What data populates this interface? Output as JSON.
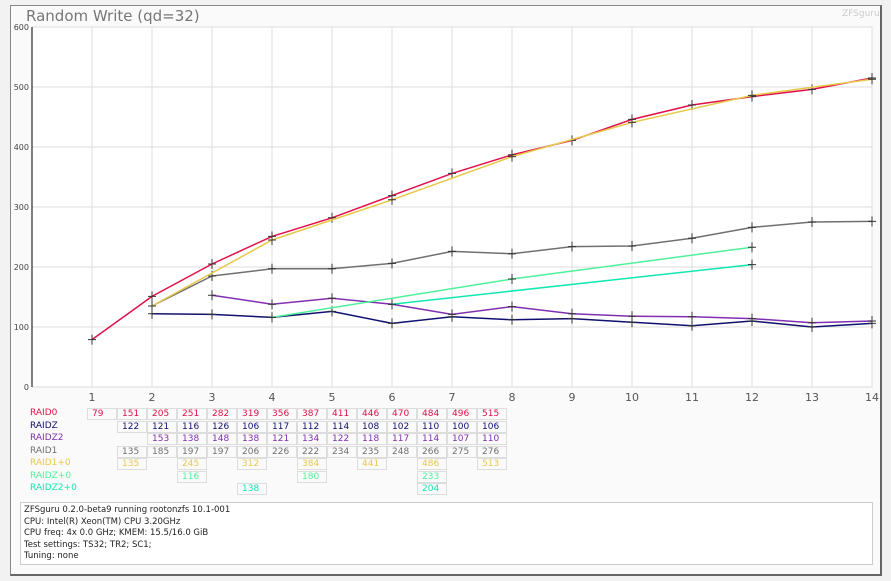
{
  "chart_data": {
    "type": "line",
    "title": "Random Write (qd=32)",
    "watermark": "ZFSguru",
    "xlim": [
      0,
      14
    ],
    "ylim": [
      0,
      600
    ],
    "x_ticks": [
      1,
      2,
      3,
      4,
      5,
      6,
      7,
      8,
      9,
      10,
      11,
      12,
      13,
      14
    ],
    "y_ticks": [
      0,
      100,
      200,
      300,
      400,
      500,
      600
    ],
    "grid": true,
    "series": [
      {
        "name": "RAID0",
        "color": "#e0104a",
        "points": [
          [
            1,
            79
          ],
          [
            2,
            151
          ],
          [
            3,
            205
          ],
          [
            4,
            251
          ],
          [
            5,
            282
          ],
          [
            6,
            319
          ],
          [
            7,
            356
          ],
          [
            8,
            387
          ],
          [
            9,
            411
          ],
          [
            10,
            446
          ],
          [
            11,
            470
          ],
          [
            12,
            484
          ],
          [
            13,
            496
          ],
          [
            14,
            515
          ]
        ]
      },
      {
        "name": "RAIDZ",
        "color": "#101070",
        "points": [
          [
            2,
            122
          ],
          [
            3,
            121
          ],
          [
            4,
            116
          ],
          [
            5,
            126
          ],
          [
            6,
            106
          ],
          [
            7,
            117
          ],
          [
            8,
            112
          ],
          [
            9,
            114
          ],
          [
            10,
            108
          ],
          [
            11,
            102
          ],
          [
            12,
            110
          ],
          [
            13,
            100
          ],
          [
            14,
            106
          ]
        ]
      },
      {
        "name": "RAIDZ2",
        "color": "#8030b0",
        "points": [
          [
            3,
            153
          ],
          [
            4,
            138
          ],
          [
            5,
            148
          ],
          [
            6,
            138
          ],
          [
            7,
            121
          ],
          [
            8,
            134
          ],
          [
            9,
            122
          ],
          [
            10,
            118
          ],
          [
            11,
            117
          ],
          [
            12,
            114
          ],
          [
            13,
            107
          ],
          [
            14,
            110
          ]
        ]
      },
      {
        "name": "RAID1",
        "color": "#707070",
        "points": [
          [
            2,
            135
          ],
          [
            3,
            185
          ],
          [
            4,
            197
          ],
          [
            5,
            197
          ],
          [
            6,
            206
          ],
          [
            7,
            226
          ],
          [
            8,
            222
          ],
          [
            9,
            234
          ],
          [
            10,
            235
          ],
          [
            11,
            248
          ],
          [
            12,
            266
          ],
          [
            13,
            275
          ],
          [
            14,
            276
          ]
        ]
      },
      {
        "name": "RAID1+0",
        "color": "#e8c84a",
        "points": [
          [
            2,
            135
          ],
          [
            4,
            245
          ],
          [
            6,
            312
          ],
          [
            8,
            384
          ],
          [
            10,
            441
          ],
          [
            12,
            486
          ],
          [
            14,
            513
          ]
        ]
      },
      {
        "name": "RAIDZ+0",
        "color": "#50f09a",
        "points": [
          [
            4,
            116
          ],
          [
            8,
            180
          ],
          [
            12,
            233
          ]
        ]
      },
      {
        "name": "RAIDZ2+0",
        "color": "#10e8b0",
        "points": [
          [
            6,
            138
          ],
          [
            12,
            204
          ]
        ]
      }
    ]
  },
  "info": [
    "ZFSguru 0.2.0-beta9 running rootonzfs 10.1-001",
    "CPU: Intel(R) Xeon(TM) CPU 3.20GHz",
    "CPU freq: 4x 0.0  GHz; KMEM: 15.5/16.0  GiB",
    "Test settings: TS32; TR2; SC1;",
    "Tuning: none"
  ]
}
